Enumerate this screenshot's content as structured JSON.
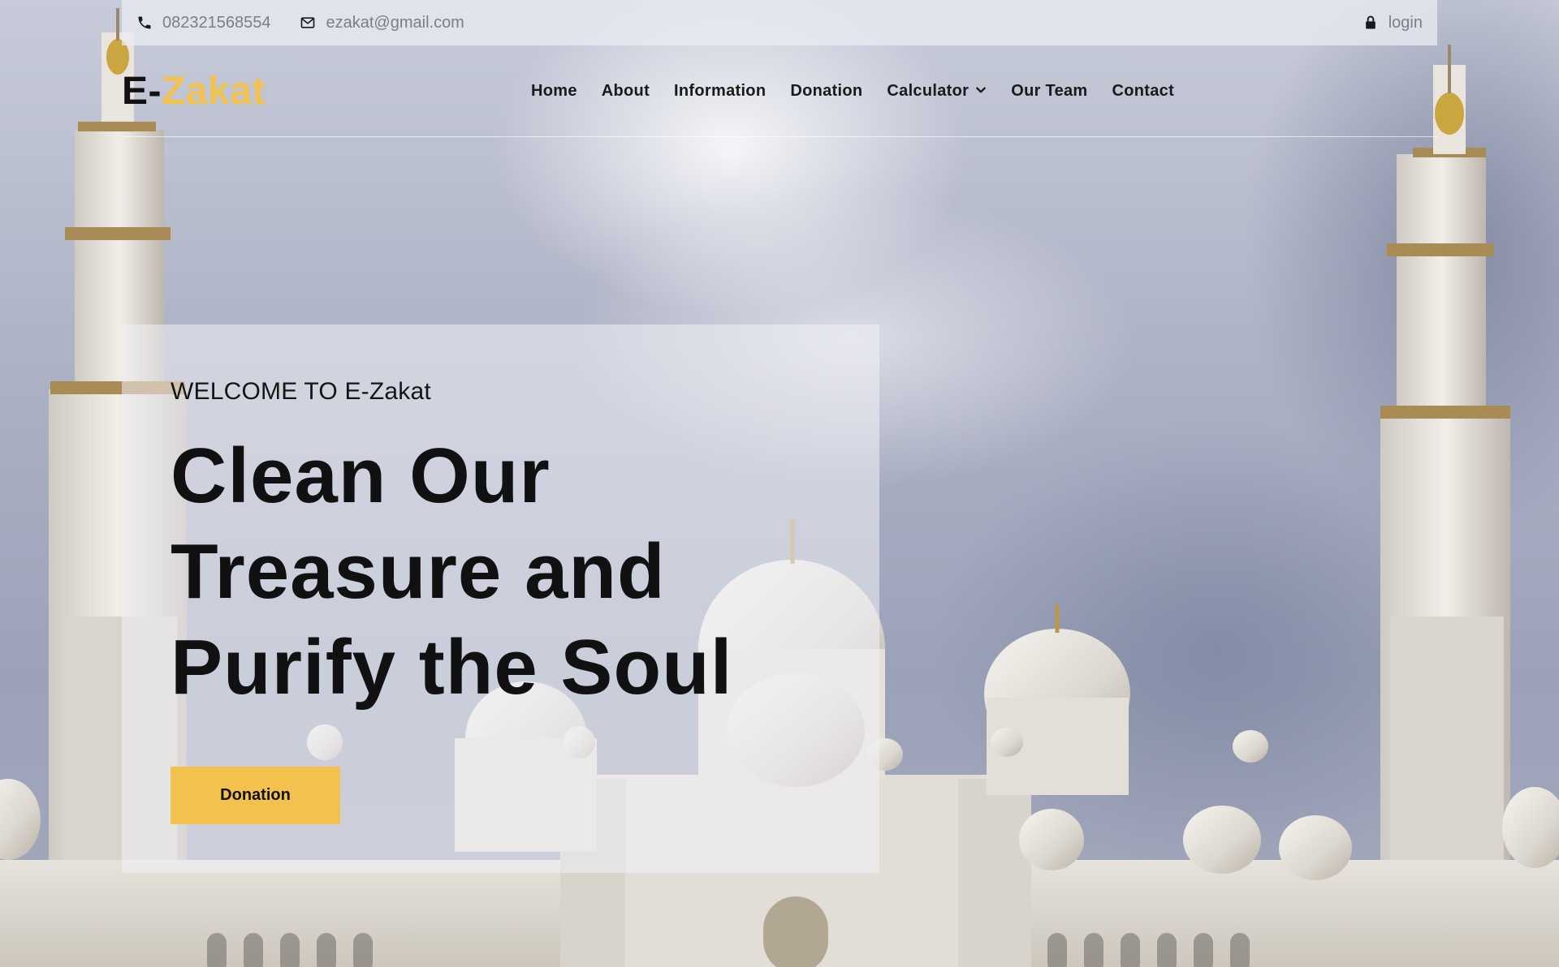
{
  "topbar": {
    "phone": "082321568554",
    "email": "ezakat@gmail.com",
    "login": "login"
  },
  "brand": {
    "prefix": "E-",
    "name": "Zakat",
    "accent_color": "#f2c14e"
  },
  "nav": {
    "items": [
      "Home",
      "About",
      "Information",
      "Donation",
      "Calculator",
      "Our Team",
      "Contact"
    ]
  },
  "hero": {
    "welcome": "WELCOME TO E-Zakat",
    "headline_lines": [
      "Clean Our",
      "Treasure and",
      "Purify the Soul"
    ],
    "button_label": "Donation"
  },
  "icons": {
    "phone": "phone-icon",
    "email": "envelope-icon",
    "login": "lock-icon",
    "dropdown": "chevron-down-icon"
  }
}
